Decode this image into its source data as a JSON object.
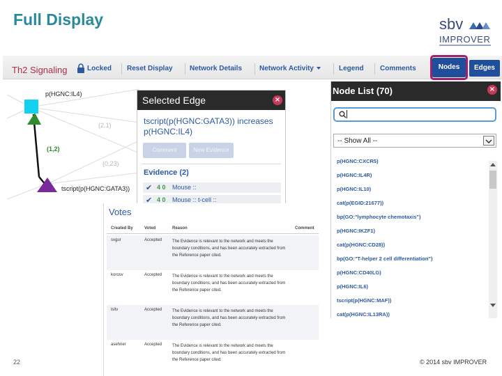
{
  "slide": {
    "title": "Full Display",
    "number": "22",
    "copyright": "© 2014 sbv IMPROVER"
  },
  "logo": {
    "brand": "sbv",
    "name": "IMPROVER"
  },
  "toolbar": {
    "network_name": "Th2 Signaling",
    "locked_label": "Locked",
    "reset_label": "Reset Display",
    "details_label": "Network Details",
    "activity_label": "Network Activity",
    "legend_label": "Legend",
    "comments_label": "Comments",
    "nodes_label": "Nodes",
    "edges_label": "Edges"
  },
  "graph": {
    "node1_label": "p(HGNC:IL4)",
    "node2_label": "tscript(p(HGNC:GATA3))",
    "edge_label_green": "(1,2)",
    "edge_label_gray1": "(2,1)",
    "edge_label_gray2": "(0,23)"
  },
  "edge_panel": {
    "title": "Selected Edge",
    "statement": "tscript(p(HGNC:GATA3)) increases p(HGNC:IL4)",
    "comment_btn": "Comment",
    "new_evidence_btn": "New Evidence",
    "evidence_title": "Evidence (2)",
    "evidence": [
      {
        "score": "4 0",
        "text": "Mouse ::"
      },
      {
        "score": "4 0",
        "text": "Mouse :: t-cell ::"
      }
    ]
  },
  "votes": {
    "title": "Votes",
    "headers": {
      "created_by": "Created By",
      "voted": "Voted",
      "reason": "Reason",
      "comment": "Comment"
    },
    "rows": [
      {
        "user": "svgur",
        "status": "Accepted",
        "reason": "The Evidence is relevant to the network and meets the boundary conditions, and has been accurately extracted from the Reference paper cited."
      },
      {
        "user": "korosv",
        "status": "Accepted",
        "reason": "The Evidence is relevant to the network and meets the boundary conditions, and has been accurately extracted from the Reference paper cited."
      },
      {
        "user": "lsitv",
        "status": "Accepted",
        "reason": "The Evidence is relevant to the network and meets the boundary conditions, and has been accurately extracted from the Reference paper cited."
      },
      {
        "user": "asehrier",
        "status": "Accepted",
        "reason": "The Evidence is relevant to the network and meets the boundary conditions, and has been accurately extracted from the Reference paper cited."
      }
    ]
  },
  "node_list": {
    "title": "Node List (70)",
    "search_value": "",
    "filter_selected": "-- Show All --",
    "items": [
      "p(HGNC:CXCR5)",
      "p(HGNC:IL4R)",
      "p(HGNC:IL10)",
      "cat(p(EGID:21677))",
      "bp(GO:\"lymphocyte chemotaxis\")",
      "p(HGNC:IKZF1)",
      "cat(p(HGNC:CD28))",
      "bp(GO:\"T-helper 2 cell differentiation\")",
      "p(HGNC:CD40LG)",
      "p(HGNC:IL6)",
      "tscript(p(HGNC:MAF))",
      "cat(p(HGNC:IL13RA))"
    ]
  },
  "colors": {
    "title_teal": "#2a8a9b",
    "nav_blue": "#1f4f9a",
    "highlight": "#a0206c",
    "network_red": "#b22a48",
    "node_cyan": "#12d0f0",
    "node_purple": "#7a2a9a",
    "edge_green": "#2e8b2e"
  }
}
